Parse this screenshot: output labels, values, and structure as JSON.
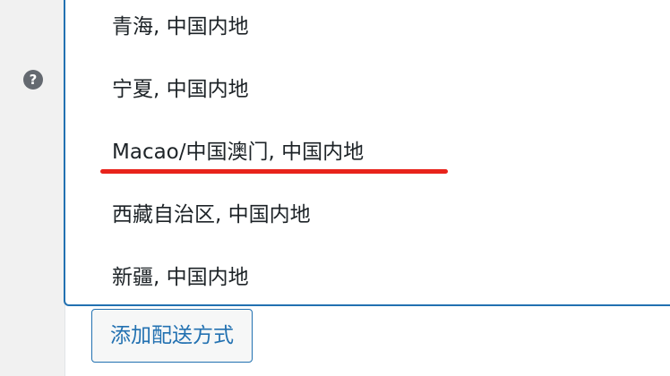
{
  "help": {
    "icon_name": "question-mark-circle-icon",
    "glyph": "?"
  },
  "dropdown": {
    "options": [
      {
        "label": "青海, 中国内地"
      },
      {
        "label": "宁夏, 中国内地"
      },
      {
        "label": "Macao/中国澳门, 中国内地",
        "highlighted": true
      },
      {
        "label": "西藏自治区, 中国内地"
      },
      {
        "label": "新疆, 中国内地"
      }
    ]
  },
  "actions": {
    "add_shipping_method_label": "添加配送方式"
  },
  "colors": {
    "accent": "#2271b1",
    "annotation_underline": "#e8231b",
    "sidebar_bg": "#f1f1f1"
  }
}
